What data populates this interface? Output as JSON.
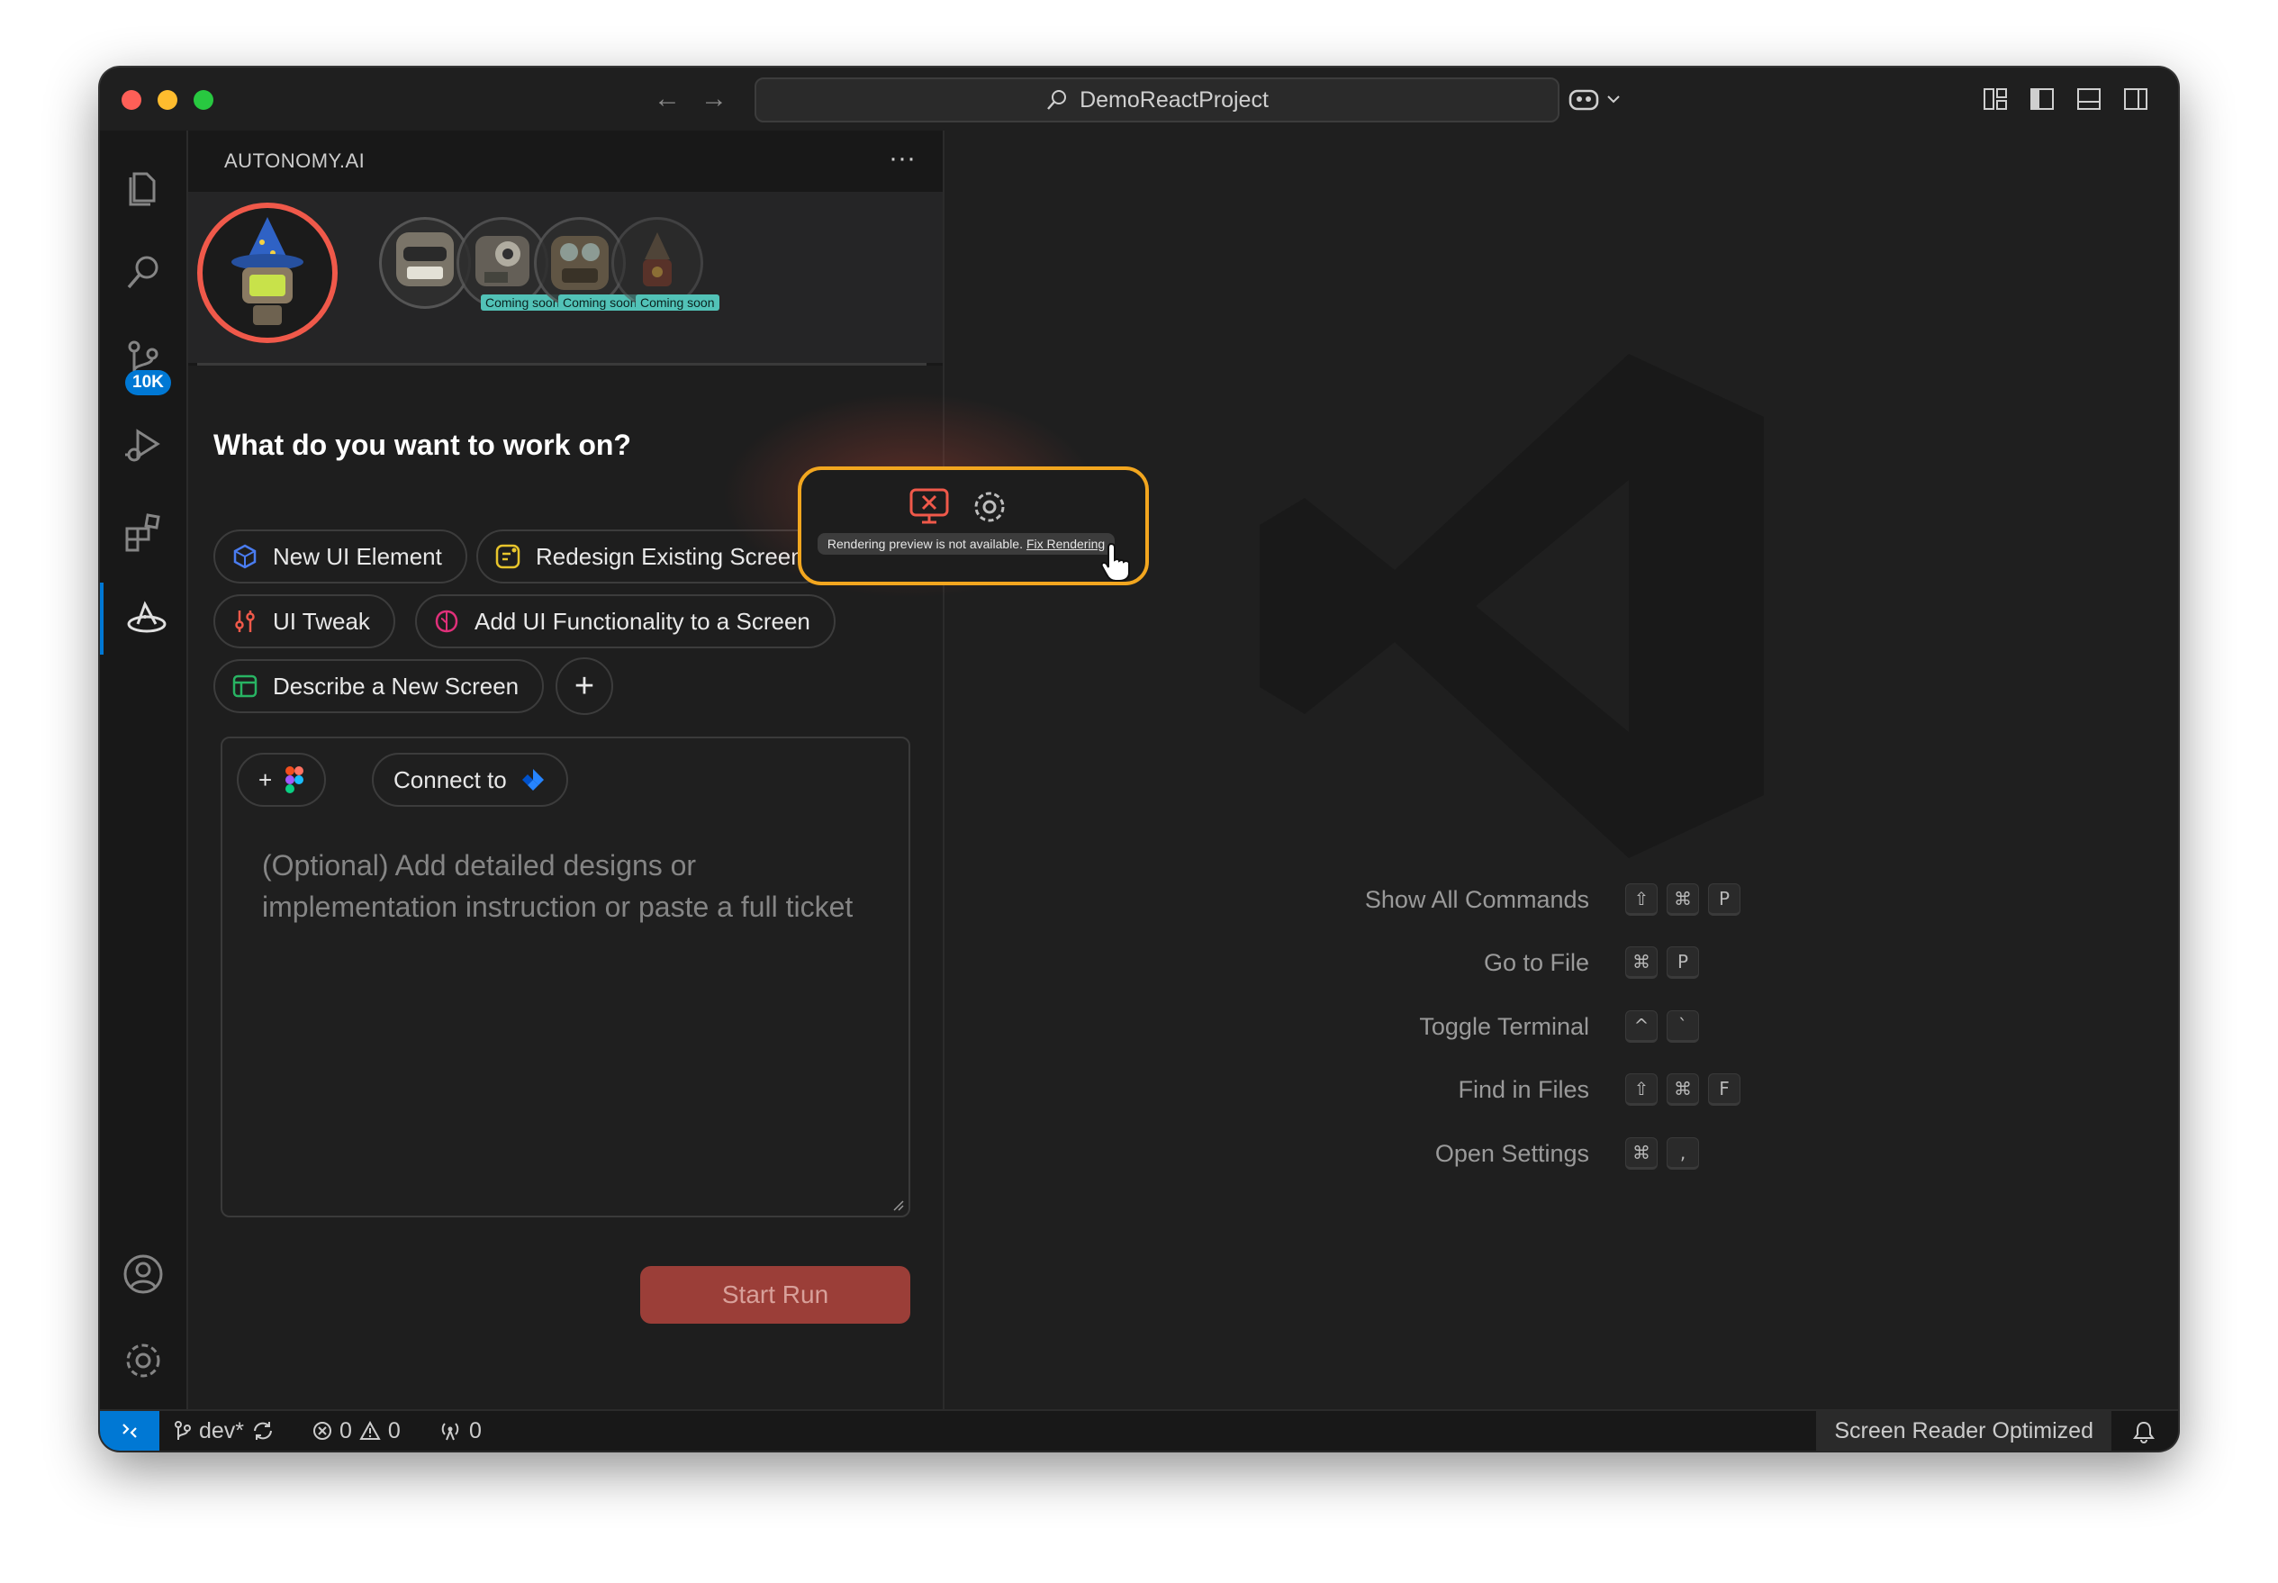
{
  "window": {
    "title": "DemoReactProject"
  },
  "activity_bar": {
    "scm_badge": "10K"
  },
  "panel": {
    "title": "AUTONOMY.AI",
    "more_label": "···",
    "agents": [
      {
        "name": "wizard",
        "selected": true
      },
      {
        "name": "robot-2"
      },
      {
        "name": "robot-3",
        "badge": "Coming soon"
      },
      {
        "name": "robot-4",
        "badge": "Coming soon"
      },
      {
        "name": "robot-5",
        "badge": "Coming soon"
      }
    ],
    "question": "What do you want to work on?",
    "chips": [
      {
        "label": "New UI Element",
        "icon": "cube-icon"
      },
      {
        "label": "Redesign Existing Screen",
        "icon": "redesign-icon"
      },
      {
        "label": "UI Tweak",
        "icon": "sliders-icon"
      },
      {
        "label": "Add UI Functionality to a Screen",
        "icon": "brain-icon"
      },
      {
        "label": "Describe a New Screen",
        "icon": "layout-icon"
      }
    ],
    "add_chip_label": "+",
    "composer": {
      "add_label": "+",
      "connect_label": "Connect to",
      "placeholder": "(Optional) Add detailed designs or implementation instruction or paste a full ticket"
    },
    "start_run_label": "Start Run"
  },
  "popup": {
    "message": "Rendering preview is not available.",
    "link": "Fix Rendering"
  },
  "editor": {
    "shortcuts": [
      {
        "label": "Show All Commands",
        "keys": [
          "⇧",
          "⌘",
          "P"
        ]
      },
      {
        "label": "Go to File",
        "keys": [
          "⌘",
          "P"
        ]
      },
      {
        "label": "Toggle Terminal",
        "keys": [
          "^",
          "`"
        ]
      },
      {
        "label": "Find in Files",
        "keys": [
          "⇧",
          "⌘",
          "F"
        ]
      },
      {
        "label": "Open Settings",
        "keys": [
          "⌘",
          ","
        ]
      }
    ]
  },
  "statusbar": {
    "branch": "dev*",
    "errors": "0",
    "warnings": "0",
    "ports": "0",
    "screen_reader": "Screen Reader Optimized"
  },
  "colors": {
    "accent": "#0078d4",
    "selected_ring": "#f0594a",
    "popup_border": "#f2a61f",
    "start_run": "#9b3e38"
  }
}
